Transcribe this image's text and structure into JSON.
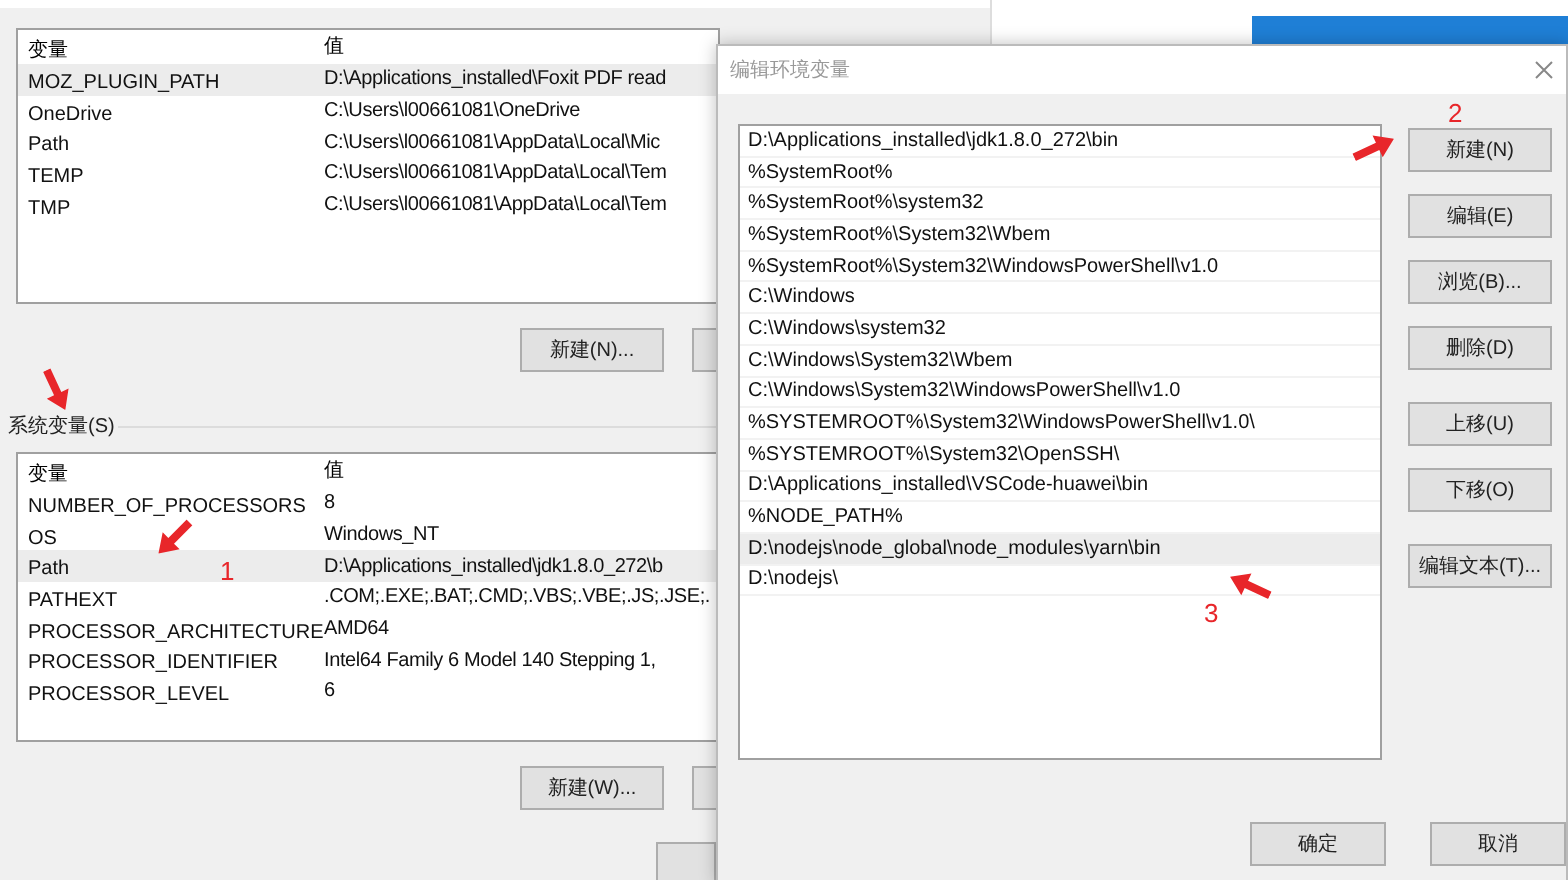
{
  "user_variables": {
    "columns": [
      "变量",
      "值"
    ],
    "rows": [
      {
        "name": "MOZ_PLUGIN_PATH",
        "value": "D:\\Applications_installed\\Foxit PDF read",
        "selected": true
      },
      {
        "name": "OneDrive",
        "value": "C:\\Users\\l00661081\\OneDrive",
        "selected": false
      },
      {
        "name": "Path",
        "value": "C:\\Users\\l00661081\\AppData\\Local\\Mic",
        "selected": false
      },
      {
        "name": "TEMP",
        "value": "C:\\Users\\l00661081\\AppData\\Local\\Tem",
        "selected": false
      },
      {
        "name": "TMP",
        "value": "C:\\Users\\l00661081\\AppData\\Local\\Tem",
        "selected": false
      }
    ],
    "buttons": [
      "新建(N)..."
    ]
  },
  "system_variables": {
    "label": "系统变量(S)",
    "columns": [
      "变量",
      "值"
    ],
    "rows": [
      {
        "name": "NUMBER_OF_PROCESSORS",
        "value": "8",
        "selected": false
      },
      {
        "name": "OS",
        "value": "Windows_NT",
        "selected": false
      },
      {
        "name": "Path",
        "value": "D:\\Applications_installed\\jdk1.8.0_272\\b",
        "selected": true
      },
      {
        "name": "PATHEXT",
        "value": ".COM;.EXE;.BAT;.CMD;.VBS;.VBE;.JS;.JSE;.",
        "selected": false
      },
      {
        "name": "PROCESSOR_ARCHITECTURE",
        "value": "AMD64",
        "selected": false
      },
      {
        "name": "PROCESSOR_IDENTIFIER",
        "value": "Intel64 Family 6 Model 140 Stepping 1,",
        "selected": false
      },
      {
        "name": "PROCESSOR_LEVEL",
        "value": "6",
        "selected": false
      }
    ],
    "buttons": [
      "新建(W)..."
    ]
  },
  "edit_dialog": {
    "title": "编辑环境变量",
    "entries": [
      {
        "text": "D:\\Applications_installed\\jdk1.8.0_272\\bin",
        "selected": false
      },
      {
        "text": "%SystemRoot%",
        "selected": false
      },
      {
        "text": "%SystemRoot%\\system32",
        "selected": false
      },
      {
        "text": "%SystemRoot%\\System32\\Wbem",
        "selected": false
      },
      {
        "text": "%SystemRoot%\\System32\\WindowsPowerShell\\v1.0",
        "selected": false
      },
      {
        "text": "C:\\Windows",
        "selected": false
      },
      {
        "text": "C:\\Windows\\system32",
        "selected": false
      },
      {
        "text": "C:\\Windows\\System32\\Wbem",
        "selected": false
      },
      {
        "text": "C:\\Windows\\System32\\WindowsPowerShell\\v1.0",
        "selected": false
      },
      {
        "text": "%SYSTEMROOT%\\System32\\WindowsPowerShell\\v1.0\\",
        "selected": false
      },
      {
        "text": "%SYSTEMROOT%\\System32\\OpenSSH\\",
        "selected": false
      },
      {
        "text": "D:\\Applications_installed\\VSCode-huawei\\bin",
        "selected": false
      },
      {
        "text": "%NODE_PATH%",
        "selected": false
      },
      {
        "text": "D:\\nodejs\\node_global\\node_modules\\yarn\\bin",
        "selected": true
      },
      {
        "text": "D:\\nodejs\\",
        "selected": false
      }
    ],
    "buttons": [
      "新建(N)",
      "编辑(E)",
      "浏览(B)...",
      "删除(D)",
      "上移(U)",
      "下移(O)",
      "编辑文本(T)..."
    ],
    "footer_buttons": [
      "确定",
      "取消"
    ]
  },
  "annotations": [
    {
      "label": "1"
    },
    {
      "label": "2"
    },
    {
      "label": "3"
    }
  ]
}
